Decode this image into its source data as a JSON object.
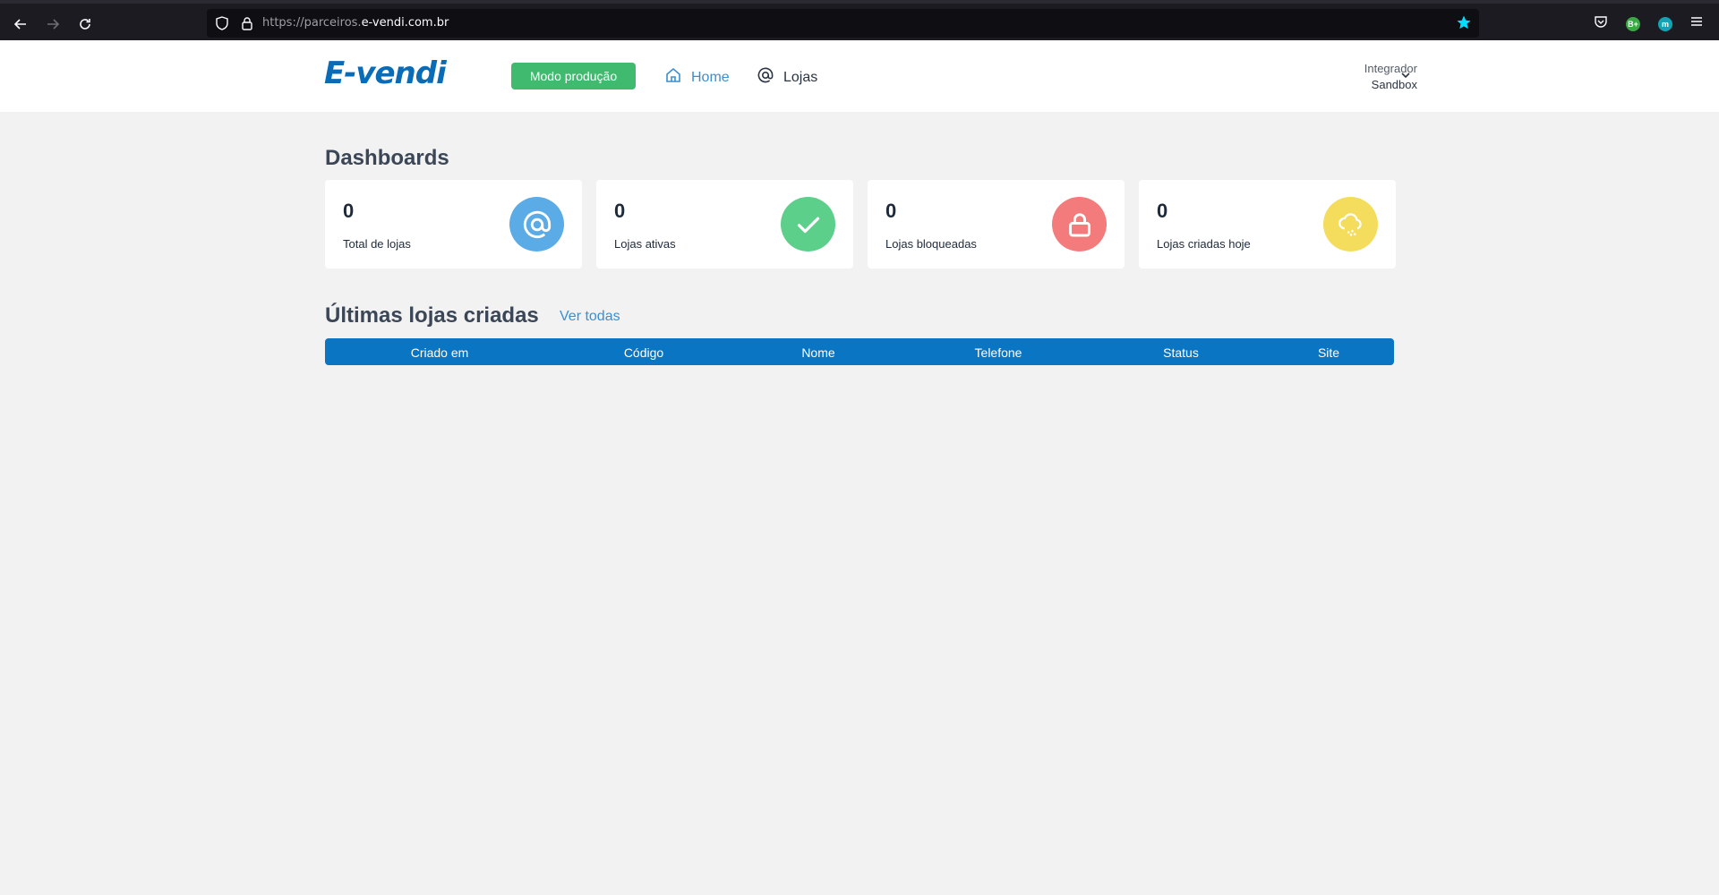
{
  "browser": {
    "url_prefix": "https://parceiros.",
    "url_domain": "e-vendi.com.br",
    "extensions": [
      "B+",
      "m"
    ]
  },
  "header": {
    "logo": "E-vendi",
    "mode_button": "Modo produção",
    "nav": {
      "home": "Home",
      "lojas": "Lojas"
    },
    "user": {
      "role": "Integrador",
      "name": "Sandbox"
    }
  },
  "dashboards": {
    "title": "Dashboards",
    "cards": [
      {
        "value": "0",
        "label": "Total de lojas",
        "icon": "at-icon",
        "color": "#5aabe6"
      },
      {
        "value": "0",
        "label": "Lojas ativas",
        "icon": "check-icon",
        "color": "#5ccf8a"
      },
      {
        "value": "0",
        "label": "Lojas bloqueadas",
        "icon": "lock-icon",
        "color": "#f47b7b"
      },
      {
        "value": "0",
        "label": "Lojas criadas hoje",
        "icon": "cloud-icon",
        "color": "#f4dc5c"
      }
    ]
  },
  "latest": {
    "title": "Últimas lojas criadas",
    "see_all": "Ver todas",
    "columns": [
      "Criado em",
      "Código",
      "Nome",
      "Telefone",
      "Status",
      "Site"
    ]
  }
}
